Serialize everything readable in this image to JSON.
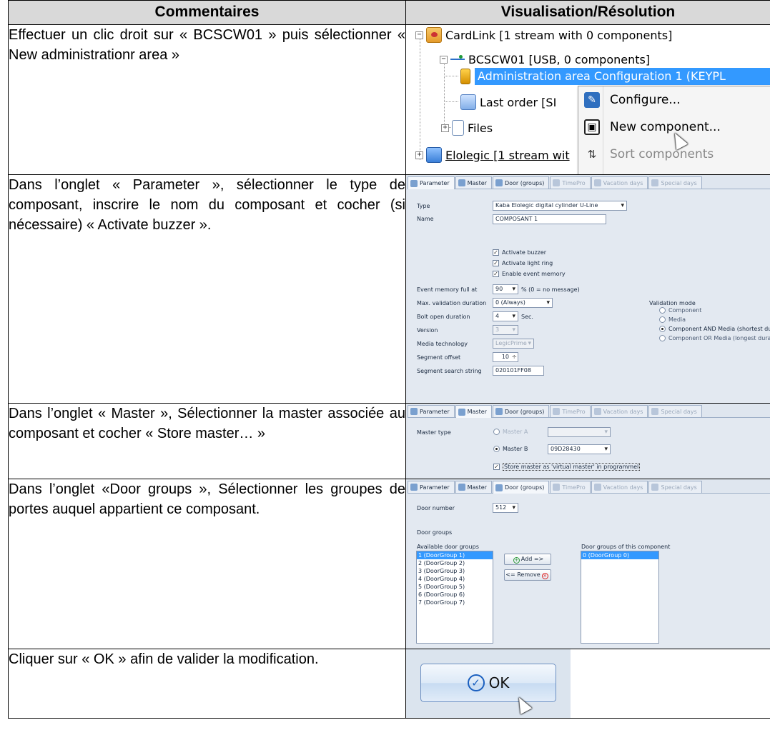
{
  "header": {
    "col1": "Commentaires",
    "col2": "Visualisation/Résolution"
  },
  "rows": [
    {
      "comment": "Effectuer un clic droit sur « BCSCW01 » puis sélectionner  « New administrationr area »"
    },
    {
      "comment": "Dans l’onglet « Parameter », sélectionner le type de composant, inscrire le nom du composant et cocher (si nécessaire) « Activate buzzer »."
    },
    {
      "comment": "Dans l’onglet « Master »,  Sélectionner la master associée au composant et cocher « Store master… »"
    },
    {
      "comment": "Dans l’onglet «Door groups », Sélectionner les groupes de portes auquel appartient ce composant."
    },
    {
      "comment": "Cliquer sur « OK » afin de valider la modification."
    }
  ],
  "tree": {
    "cardlink": "CardLink [1 stream with 0 components]",
    "bcscw01": "BCSCW01 [USB, 0 components]",
    "admin_area": "Administration area Configuration 1 (KEYPL",
    "last_order": "Last order [SI",
    "files": "Files",
    "elolegic": "Elolegic [1 stream wit",
    "menu": {
      "configure": "Configure...",
      "new_component": "New component...",
      "sort_components": "Sort components"
    }
  },
  "tabs": {
    "parameter": "Parameter",
    "master": "Master",
    "door_groups": "Door (groups)",
    "timepro": "TimePro",
    "vacation_days": "Vacation days",
    "special_days": "Special days"
  },
  "param": {
    "type_label": "Type",
    "type_value": "Kaba Elolegic digital cylinder U-Line",
    "name_label": "Name",
    "name_value": "COMPOSANT 1",
    "activate_buzzer": "Activate buzzer",
    "activate_light_ring": "Activate light ring",
    "enable_event_memory": "Enable event memory",
    "event_memory_label": "Event memory full at",
    "event_memory_value": "90",
    "event_memory_unit": "% (0 = no message)",
    "max_validation_label": "Max. validation duration",
    "max_validation_value": "0 (Always)",
    "bolt_open_label": "Bolt open duration",
    "bolt_open_value": "4",
    "bolt_open_unit": "Sec.",
    "version_label": "Version",
    "version_value": "3",
    "media_tech_label": "Media technology",
    "media_tech_value": "LegicPrime",
    "segment_offset_label": "Segment offset",
    "segment_offset_value": "10",
    "segment_search_label": "Segment search string",
    "segment_search_value": "020101FF08",
    "validation_mode_label": "Validation mode",
    "vm_component": "Component",
    "vm_media": "Media",
    "vm_and": "Component AND Media (shortest duration",
    "vm_or": "Component OR Media (longest duration v"
  },
  "master": {
    "master_type_label": "Master type",
    "master_a": "Master A",
    "master_b": "Master B",
    "master_b_value": "09D28430",
    "store_master": "Store master as 'virtual master' in programmel"
  },
  "doors": {
    "door_number_label": "Door number",
    "door_number_value": "512",
    "door_groups_label": "Door groups",
    "available_label": "Available door groups",
    "component_label": "Door groups of this component",
    "available": [
      "1 (DoorGroup 1)",
      "2 (DoorGroup 2)",
      "3 (DoorGroup 3)",
      "4 (DoorGroup 4)",
      "5 (DoorGroup 5)",
      "6 (DoorGroup 6)",
      "7 (DoorGroup 7)"
    ],
    "assigned": [
      "0 (DoorGroup 0)"
    ],
    "add_label": "Add =>",
    "remove_label": "<= Remove"
  },
  "ok": {
    "label": "OK"
  },
  "colors": {
    "selection": "#3399ff",
    "dialog_bg": "#e3e9f1",
    "header_bg": "#d9d9d9"
  }
}
